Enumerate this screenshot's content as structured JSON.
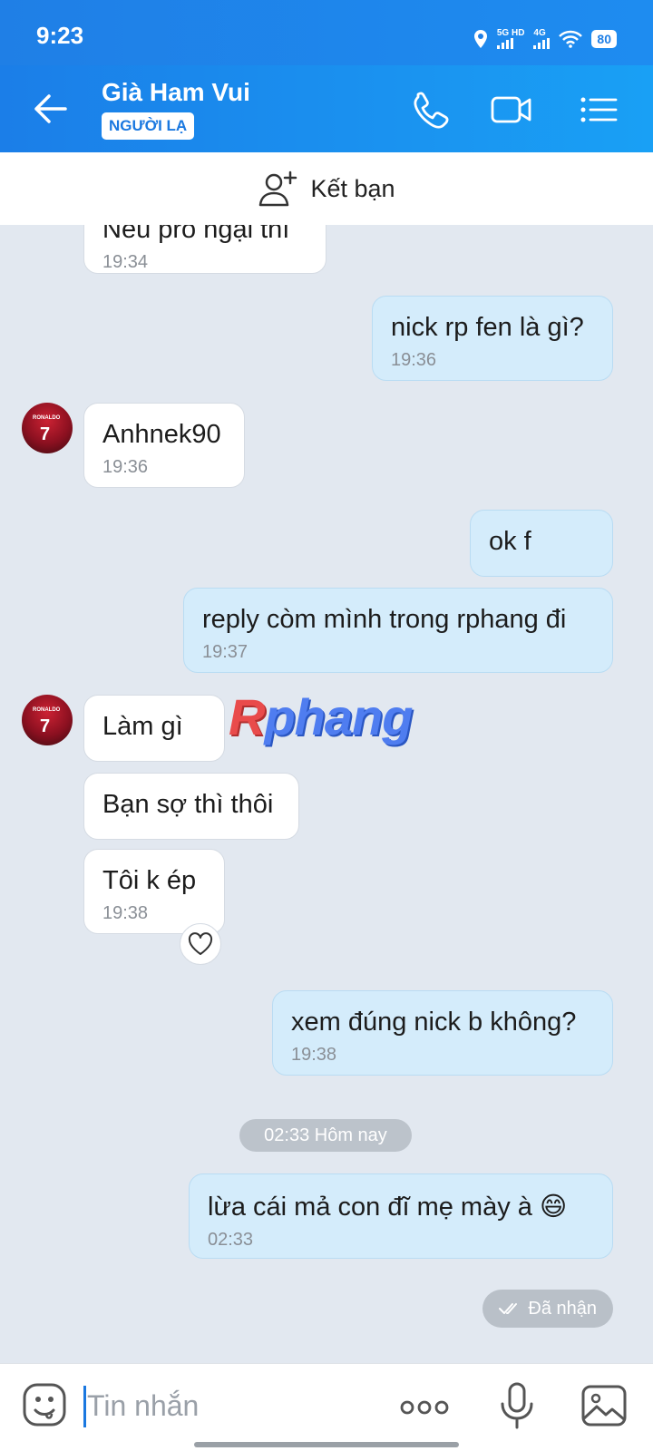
{
  "status_bar": {
    "time": "9:23",
    "net1": "5G HD",
    "net2": "4G",
    "battery": "80"
  },
  "header": {
    "name": "Già Ham Vui",
    "badge": "NGƯỜI LẠ"
  },
  "add_friend": {
    "label": "Kết bạn"
  },
  "messages": [
    {
      "side": "in",
      "text": "Nếu pro ngại thì",
      "time": "19:34"
    },
    {
      "side": "out",
      "text": "nick rp fen là gì?",
      "time": "19:36"
    },
    {
      "side": "in",
      "text": "Anhnek90",
      "time": "19:36"
    },
    {
      "side": "out",
      "text": "ok f",
      "time": ""
    },
    {
      "side": "out",
      "text": "reply còm mình trong rphang đi",
      "time": "19:37"
    },
    {
      "side": "in",
      "text": "Làm gì",
      "time": ""
    },
    {
      "side": "in",
      "text": "Bạn sợ thì thôi",
      "time": ""
    },
    {
      "side": "in",
      "text": "Tôi k ép",
      "time": "19:38"
    },
    {
      "side": "out",
      "text": "xem đúng nick b không?",
      "time": "19:38"
    },
    {
      "side": "out",
      "text": "lừa cái mả con đĩ mẹ mày à 😄",
      "time": "02:33"
    }
  ],
  "date_separator": "02:33 Hôm nay",
  "delivery_status": "Đã nhận",
  "avatar_label": {
    "name": "RONALDO",
    "number": "7"
  },
  "watermark": {
    "r": "R",
    "rest": "phang"
  },
  "input": {
    "placeholder": "Tin nhắn"
  },
  "icons": [
    "back-arrow-icon",
    "phone-icon",
    "video-call-icon",
    "menu-list-icon",
    "add-friend-icon",
    "heart-icon",
    "double-check-icon",
    "emoji-icon",
    "more-icon",
    "mic-icon",
    "gallery-icon"
  ],
  "colors": {
    "header": "#1b7ee8",
    "outgoing_bubble": "#d4ecfb",
    "incoming_bubble": "#ffffff",
    "chat_background": "#e2e8f0"
  }
}
